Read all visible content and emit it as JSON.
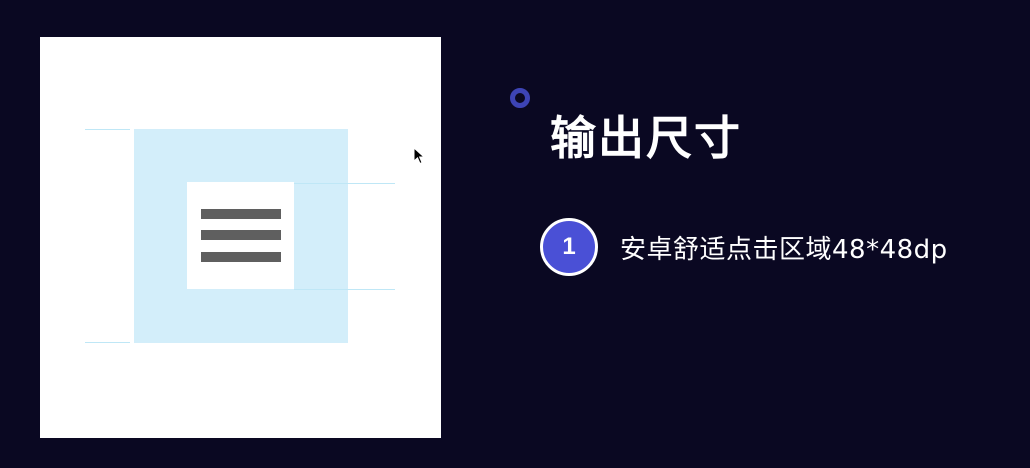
{
  "title": "输出尺寸",
  "items": [
    {
      "number": "1",
      "text": "安卓舒适点击区域48*48dp"
    }
  ],
  "colors": {
    "background": "#0a0822",
    "canvas": "#ffffff",
    "touch_area": "#d3eefa",
    "icon_bars": "#5f5f5f",
    "accent": "#4a50d6",
    "ring": "#3d44b5"
  },
  "icons": {
    "illustration": "hamburger-menu-icon",
    "pointer": "mouse-cursor-icon"
  }
}
